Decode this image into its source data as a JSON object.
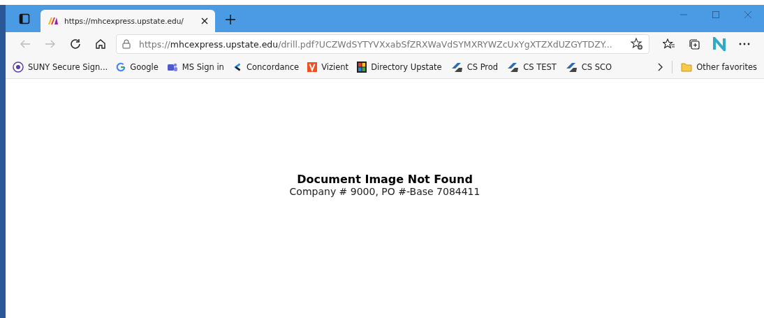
{
  "tabs": [
    {
      "title": "https://mhcexpress.upstate.edu/",
      "selected": true
    }
  ],
  "address_bar": {
    "scheme": "https://",
    "host": "mhcexpress.upstate.edu",
    "path": "/drill.pdf?UCZWdSYTYVXxabSfZRXWaVdSYMXRYWZcUxYgXTZXdUZGYTDZY..."
  },
  "bookmarks": [
    {
      "label": "SUNY Secure Sign...",
      "kind": "suny"
    },
    {
      "label": "Google",
      "kind": "google"
    },
    {
      "label": "MS Sign in",
      "kind": "teams"
    },
    {
      "label": "Concordance",
      "kind": "concordance"
    },
    {
      "label": "Vizient",
      "kind": "vizient"
    },
    {
      "label": "Directory Upstate",
      "kind": "directory"
    },
    {
      "label": "CS Prod",
      "kind": "cs"
    },
    {
      "label": "CS TEST",
      "kind": "cs"
    },
    {
      "label": "CS SCO",
      "kind": "cs"
    }
  ],
  "other_favorites": "Other favorites",
  "page": {
    "heading": "Document Image Not Found",
    "detail": "Company # 9000, PO #-Base 7084411"
  }
}
